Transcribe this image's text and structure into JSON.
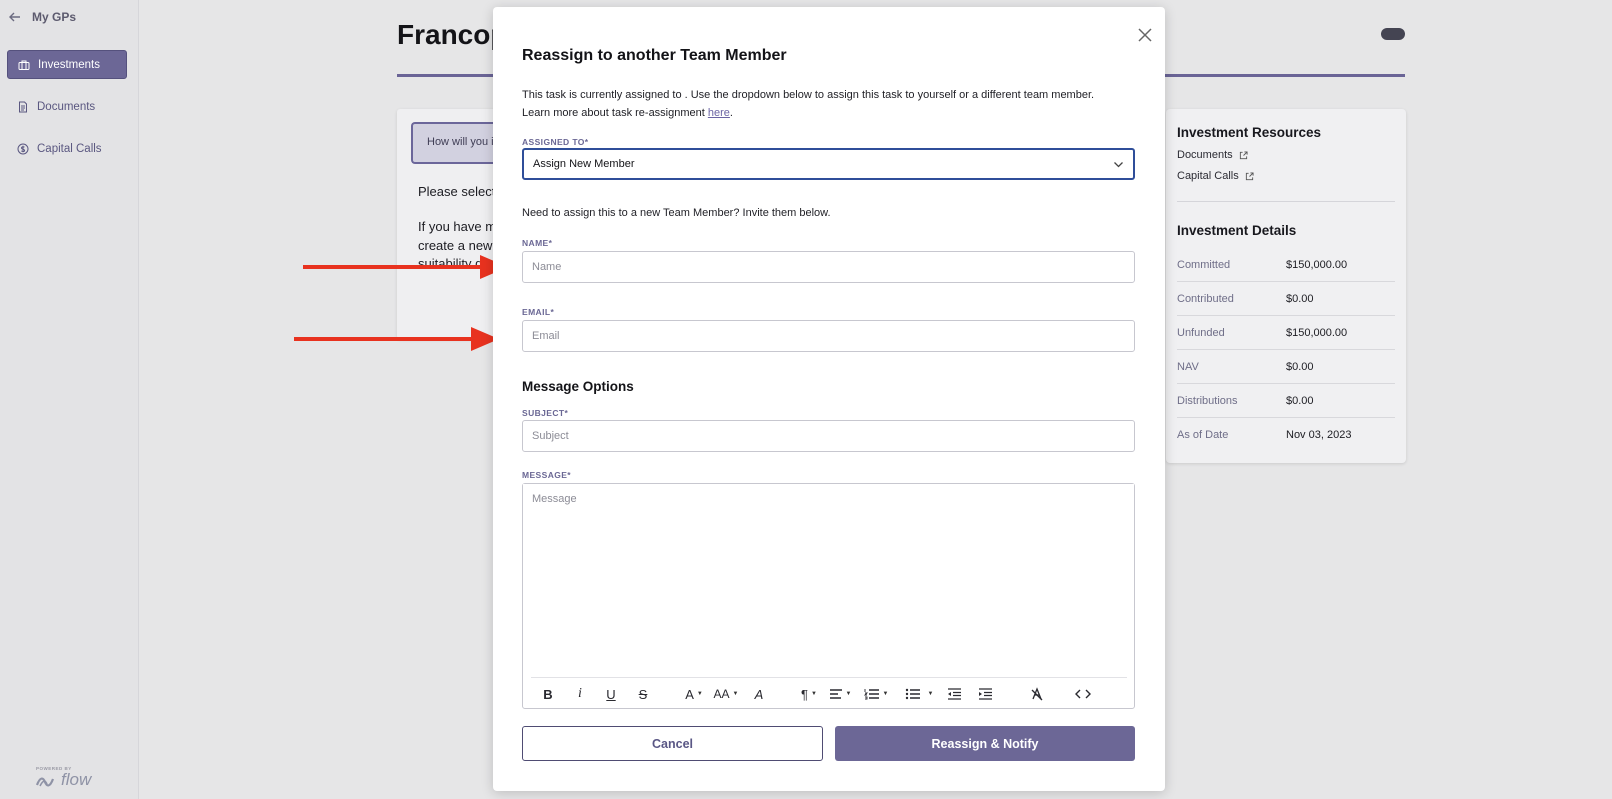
{
  "sidebar": {
    "back_label": "My GPs",
    "items": [
      {
        "label": "Investments",
        "icon": "briefcase-icon",
        "active": true
      },
      {
        "label": "Documents",
        "icon": "document-icon",
        "active": false
      },
      {
        "label": "Capital Calls",
        "icon": "dollar-circle-icon",
        "active": false
      }
    ],
    "powered_by": "POWERED BY",
    "brand": "flow"
  },
  "page": {
    "title": "Francop",
    "question_box": "How will you i",
    "body_lines": [
      "Please select",
      "If you have m",
      "create a new",
      "suitability q"
    ]
  },
  "resources": {
    "heading": "Investment Resources",
    "links": [
      "Documents",
      "Capital Calls"
    ],
    "details_heading": "Investment Details",
    "details": [
      {
        "label": "Committed",
        "value": "$150,000.00"
      },
      {
        "label": "Contributed",
        "value": "$0.00"
      },
      {
        "label": "Unfunded",
        "value": "$150,000.00"
      },
      {
        "label": "NAV",
        "value": "$0.00"
      },
      {
        "label": "Distributions",
        "value": "$0.00"
      },
      {
        "label": "As of Date",
        "value": "Nov 03, 2023"
      }
    ]
  },
  "modal": {
    "title": "Reassign to another Team Member",
    "intro_text": "This task is currently assigned to . Use the dropdown below to assign this task to yourself or a different team member. Learn more about task re-assignment ",
    "intro_link": "here",
    "intro_end": ".",
    "assigned_label": "ASSIGNED TO*",
    "assigned_value": "Assign New Member",
    "help_text": "Need to assign this to a new Team Member? Invite them below.",
    "name_label": "NAME*",
    "name_placeholder": "Name",
    "email_label": "EMAIL*",
    "email_placeholder": "Email",
    "options_heading": "Message Options",
    "subject_label": "SUBJECT*",
    "subject_placeholder": "Subject",
    "message_label": "MESSAGE*",
    "message_placeholder": "Message",
    "toolbar": {
      "bold": "B",
      "italic": "i",
      "underline": "U",
      "strike": "S",
      "font": "A",
      "size": "AA",
      "color": "A",
      "paragraph": "¶",
      "code": "<>"
    },
    "cancel_label": "Cancel",
    "submit_label": "Reassign & Notify"
  },
  "colors": {
    "accent": "#6c6796",
    "focus_border": "#2f4e99",
    "annotation_arrow": "#e8321f"
  }
}
